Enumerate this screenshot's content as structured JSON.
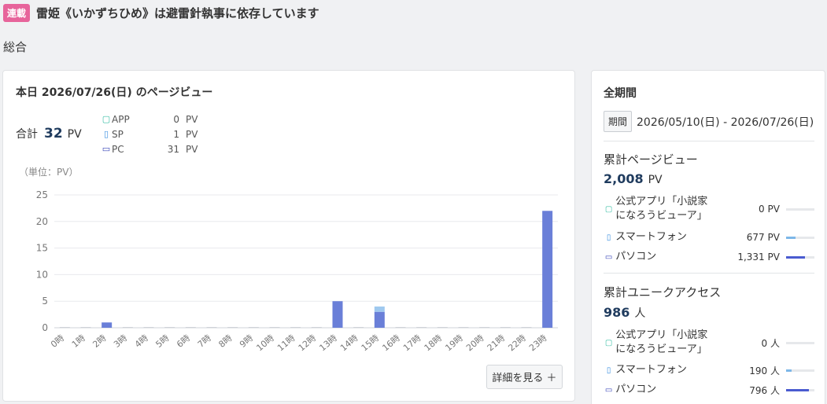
{
  "header": {
    "badge": "連載",
    "title": "雷姫《いかずちひめ》は避雷針執事に依存しています"
  },
  "section_label": "総合",
  "today": {
    "title": "本日 2026/07/26(日) のページビュー",
    "total_label": "合計",
    "total_value": "32",
    "total_unit": "PV",
    "breakdown": [
      {
        "icon": "app-icon",
        "label": "APP",
        "value": "0",
        "unit": "PV"
      },
      {
        "icon": "smartphone-icon",
        "label": "SP",
        "value": "1",
        "unit": "PV"
      },
      {
        "icon": "pc-icon",
        "label": "PC",
        "value": "31",
        "unit": "PV"
      }
    ],
    "unit_note": "（単位：PV）",
    "detail_button": "詳細を見る ＋"
  },
  "chart_data": {
    "type": "bar",
    "categories": [
      "0時",
      "1時",
      "2時",
      "3時",
      "4時",
      "5時",
      "6時",
      "7時",
      "8時",
      "9時",
      "10時",
      "11時",
      "12時",
      "13時",
      "14時",
      "15時",
      "16時",
      "17時",
      "18時",
      "19時",
      "20時",
      "21時",
      "22時",
      "23時"
    ],
    "series": [
      {
        "values": [
          0,
          0,
          1,
          0,
          0,
          0,
          0,
          0,
          0,
          0,
          0,
          0,
          0,
          5,
          0,
          3,
          0,
          0,
          0,
          0,
          0,
          0,
          0,
          22
        ],
        "color": "#6a7fd8"
      },
      {
        "values": [
          0,
          0,
          0,
          0,
          0,
          0,
          0,
          0,
          0,
          0,
          0,
          0,
          0,
          0,
          0,
          1,
          0,
          0,
          0,
          0,
          0,
          0,
          0,
          0
        ],
        "color": "#9fc9ef"
      }
    ],
    "yticks": [
      0,
      5,
      10,
      15,
      20,
      25
    ],
    "ylim": [
      0,
      25
    ],
    "stacked": true,
    "grid": true
  },
  "all_time": {
    "title": "全期間",
    "period_tag": "期間",
    "period_range": "2026/05/10(日) - 2026/07/26(日)",
    "pv": {
      "title": "累計ページビュー",
      "total_value": "2,008",
      "total_unit": "PV",
      "rows": [
        {
          "icon": "app-icon",
          "label": "公式アプリ「小説家になろうビューア」",
          "value": "0 PV",
          "ratio": 0,
          "color": "#3cbfa6"
        },
        {
          "icon": "smartphone-icon",
          "label": "スマートフォン",
          "value": "677 PV",
          "ratio": 0.34,
          "color": "#7db7e8"
        },
        {
          "icon": "pc-icon",
          "label": "パソコン",
          "value": "1,331 PV",
          "ratio": 0.66,
          "color": "#4a5bd0"
        }
      ]
    },
    "ua": {
      "title": "累計ユニークアクセス",
      "total_value": "986",
      "total_unit": "人",
      "rows": [
        {
          "icon": "app-icon",
          "label": "公式アプリ「小説家になろうビューア」",
          "value": "0 人",
          "ratio": 0,
          "color": "#3cbfa6"
        },
        {
          "icon": "smartphone-icon",
          "label": "スマートフォン",
          "value": "190 人",
          "ratio": 0.19,
          "color": "#7db7e8"
        },
        {
          "icon": "pc-icon",
          "label": "パソコン",
          "value": "796 人",
          "ratio": 0.81,
          "color": "#4a5bd0"
        }
      ]
    }
  }
}
